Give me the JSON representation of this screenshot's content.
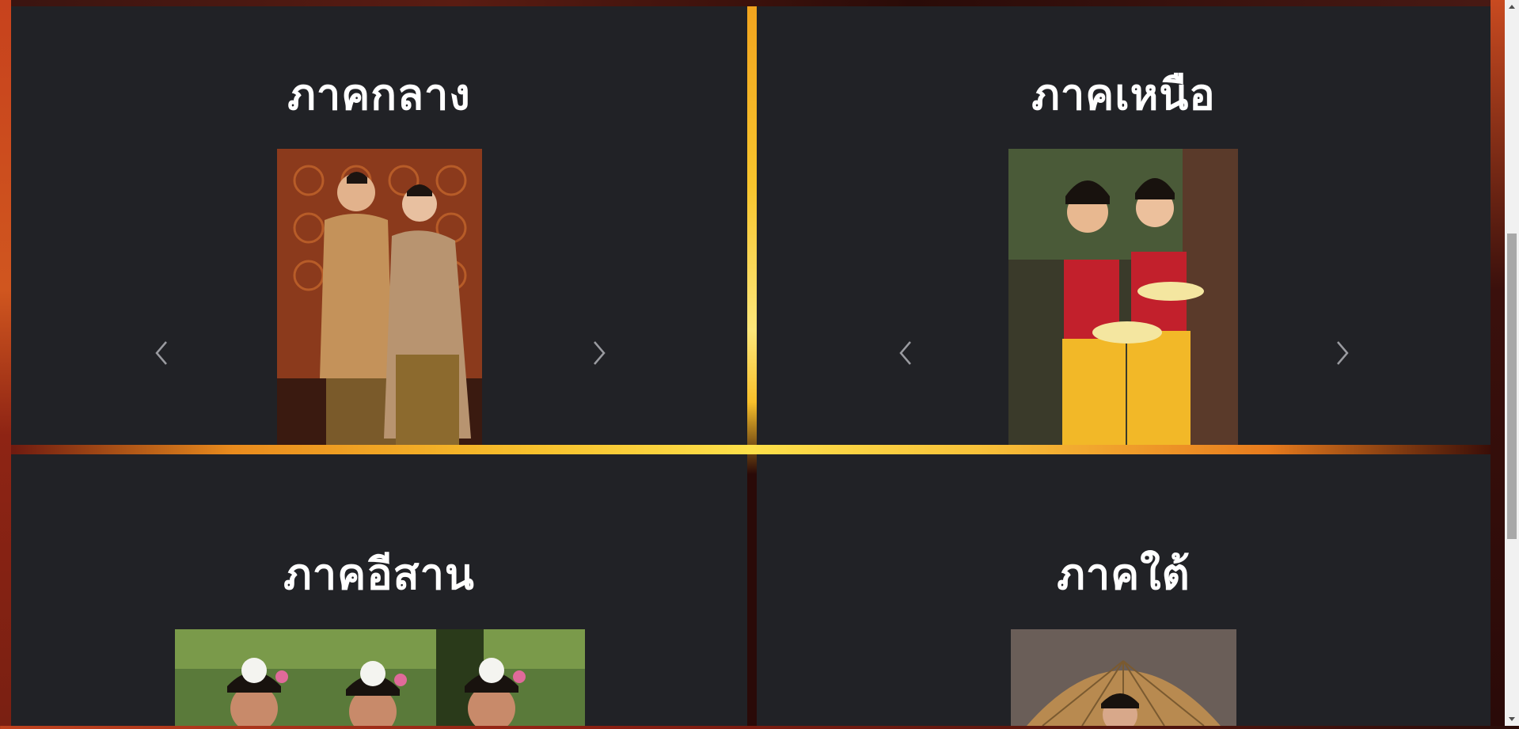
{
  "panels": [
    {
      "id": "central",
      "title": "ภาคกลาง",
      "photo_alt": "Couple in traditional Central Thai gold silk attire",
      "prev_icon": "chevron-left-icon",
      "next_icon": "chevron-right-icon"
    },
    {
      "id": "north",
      "title": "ภาคเหนือ",
      "photo_alt": "Two women in Northern Thai red and yellow attire holding offering bowls",
      "prev_icon": "chevron-left-icon",
      "next_icon": "chevron-right-icon"
    },
    {
      "id": "isan",
      "title": "ภาคอีสาน",
      "photo_alt": "Three women in Isan traditional dress with flower hairpieces"
    },
    {
      "id": "south",
      "title": "ภาคใต้",
      "photo_alt": "Woman with paper umbrella in Southern Thai attire"
    }
  ],
  "colors": {
    "panel_bg": "#212226",
    "title_text": "#ffffff",
    "accent_yellow": "#f8c52d",
    "accent_red": "#8a1f12"
  }
}
